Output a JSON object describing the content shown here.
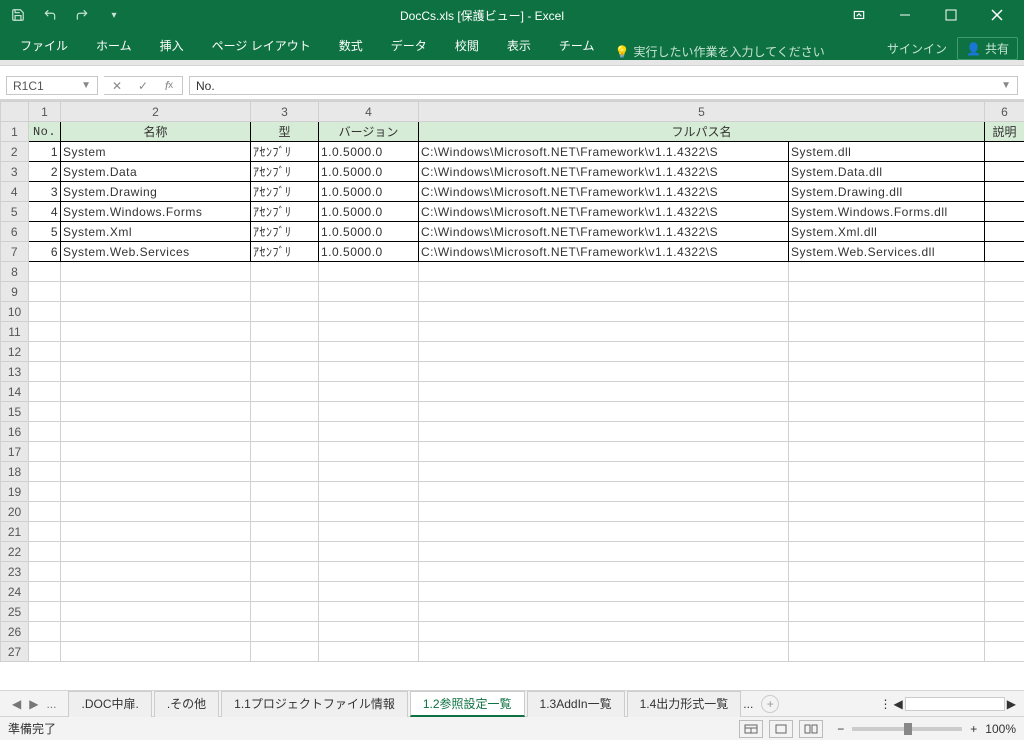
{
  "window": {
    "title": "DocCs.xls  [保護ビュー] - Excel"
  },
  "ribbon": {
    "tabs": [
      "ファイル",
      "ホーム",
      "挿入",
      "ページ レイアウト",
      "数式",
      "データ",
      "校閲",
      "表示",
      "チーム"
    ],
    "tell_placeholder": "実行したい作業を入力してください",
    "signin": "サインイン",
    "share": "共有"
  },
  "formula_bar": {
    "name_box": "R1C1",
    "formula": "No."
  },
  "sheet": {
    "col_headers": [
      "1",
      "2",
      "3",
      "4",
      "5",
      "6"
    ],
    "row_headers": [
      "1",
      "2",
      "3",
      "4",
      "5",
      "6",
      "7",
      "8",
      "9",
      "10",
      "11",
      "12",
      "13",
      "14",
      "15",
      "16",
      "17",
      "18",
      "19",
      "20",
      "21",
      "22",
      "23",
      "24",
      "25",
      "26",
      "27"
    ],
    "header_row": {
      "no": "No.",
      "name": "名称",
      "type": "型",
      "version": "バージョン",
      "fullpath": "フルパス名",
      "desc": "説明"
    },
    "data": [
      {
        "no": "1",
        "name": "System",
        "type": "ｱｾﾝﾌﾞﾘ",
        "version": "1.0.5000.0",
        "path": "C:\\Windows\\Microsoft.NET\\Framework\\v1.1.4322\\S",
        "dll": "System.dll"
      },
      {
        "no": "2",
        "name": "System.Data",
        "type": "ｱｾﾝﾌﾞﾘ",
        "version": "1.0.5000.0",
        "path": "C:\\Windows\\Microsoft.NET\\Framework\\v1.1.4322\\S",
        "dll": "System.Data.dll"
      },
      {
        "no": "3",
        "name": "System.Drawing",
        "type": "ｱｾﾝﾌﾞﾘ",
        "version": "1.0.5000.0",
        "path": "C:\\Windows\\Microsoft.NET\\Framework\\v1.1.4322\\S",
        "dll": "System.Drawing.dll"
      },
      {
        "no": "4",
        "name": "System.Windows.Forms",
        "type": "ｱｾﾝﾌﾞﾘ",
        "version": "1.0.5000.0",
        "path": "C:\\Windows\\Microsoft.NET\\Framework\\v1.1.4322\\S",
        "dll": "System.Windows.Forms.dll"
      },
      {
        "no": "5",
        "name": "System.Xml",
        "type": "ｱｾﾝﾌﾞﾘ",
        "version": "1.0.5000.0",
        "path": "C:\\Windows\\Microsoft.NET\\Framework\\v1.1.4322\\S",
        "dll": "System.Xml.dll"
      },
      {
        "no": "6",
        "name": "System.Web.Services",
        "type": "ｱｾﾝﾌﾞﾘ",
        "version": "1.0.5000.0",
        "path": "C:\\Windows\\Microsoft.NET\\Framework\\v1.1.4322\\S",
        "dll": "System.Web.Services.dll"
      }
    ]
  },
  "sheet_tabs": {
    "items": [
      ".DOC中扉.",
      ".その他",
      "1.1プロジェクトファイル情報",
      "1.2参照設定一覧",
      "1.3AddIn一覧",
      "1.4出力形式一覧"
    ],
    "more": "...",
    "active_index": 3
  },
  "status": {
    "ready": "準備完了",
    "zoom": "100%"
  }
}
